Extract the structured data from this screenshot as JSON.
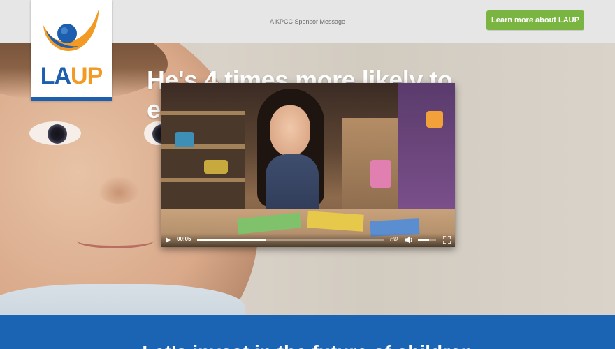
{
  "header": {
    "sponsor_text": "A KPCC Sponsor Message",
    "cta_label": "Learn more about LAUP"
  },
  "logo": {
    "text_primary": "LA",
    "text_accent": "UP",
    "colors": {
      "blue": "#1d5fae",
      "orange": "#f29a24"
    }
  },
  "hero": {
    "headline": "He's 4 times more likely to earn"
  },
  "video": {
    "timecode": "00:05",
    "quality_badge": "HD",
    "progress": 0.37,
    "volume": 0.6,
    "icons": [
      "play-icon",
      "volume-icon",
      "fullscreen-icon"
    ]
  },
  "bottom_band": {
    "color": "#1b64b4",
    "partial_text": "Let's invest in the future of children"
  },
  "colors": {
    "cta": "#7ab542",
    "topbar": "#e6e6e6"
  }
}
